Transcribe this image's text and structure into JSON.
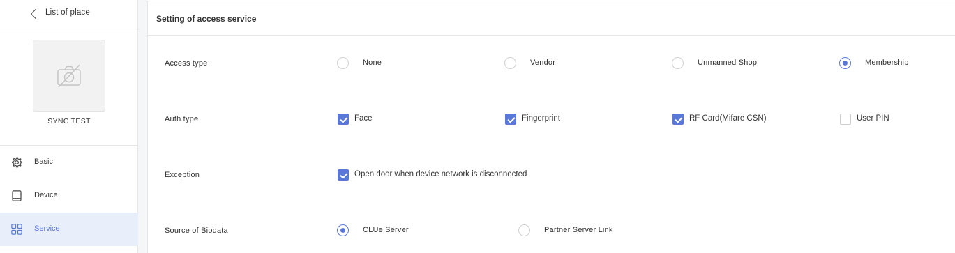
{
  "sidebar": {
    "back_label": "List of place",
    "place_name": "SYNC TEST",
    "nav": [
      {
        "label": "Basic",
        "icon": "gear-icon"
      },
      {
        "label": "Device",
        "icon": "tablet-icon"
      },
      {
        "label": "Service",
        "icon": "grid-icon"
      }
    ],
    "active_item": "Service"
  },
  "section": {
    "title": "Setting of access service",
    "access_type": {
      "label": "Access type",
      "options": [
        "None",
        "Vendor",
        "Unmanned Shop",
        "Membership"
      ],
      "selected": "Membership"
    },
    "auth_type": {
      "label": "Auth type",
      "options": [
        {
          "label": "Face",
          "checked": true
        },
        {
          "label": "Fingerprint",
          "checked": true
        },
        {
          "label": "RF Card(Mifare CSN)",
          "checked": true
        },
        {
          "label": "User PIN",
          "checked": false
        }
      ]
    },
    "exception": {
      "label": "Exception",
      "option": {
        "label": "Open door when device network is disconnected",
        "checked": true
      }
    },
    "source_of_biodata": {
      "label": "Source of Biodata",
      "options": [
        "CLUe Server",
        "Partner Server Link"
      ],
      "selected": "CLUe Server"
    }
  },
  "colors": {
    "accent": "#5a78d8",
    "active_bg": "#e9eefb",
    "border": "#e6e6e6"
  }
}
